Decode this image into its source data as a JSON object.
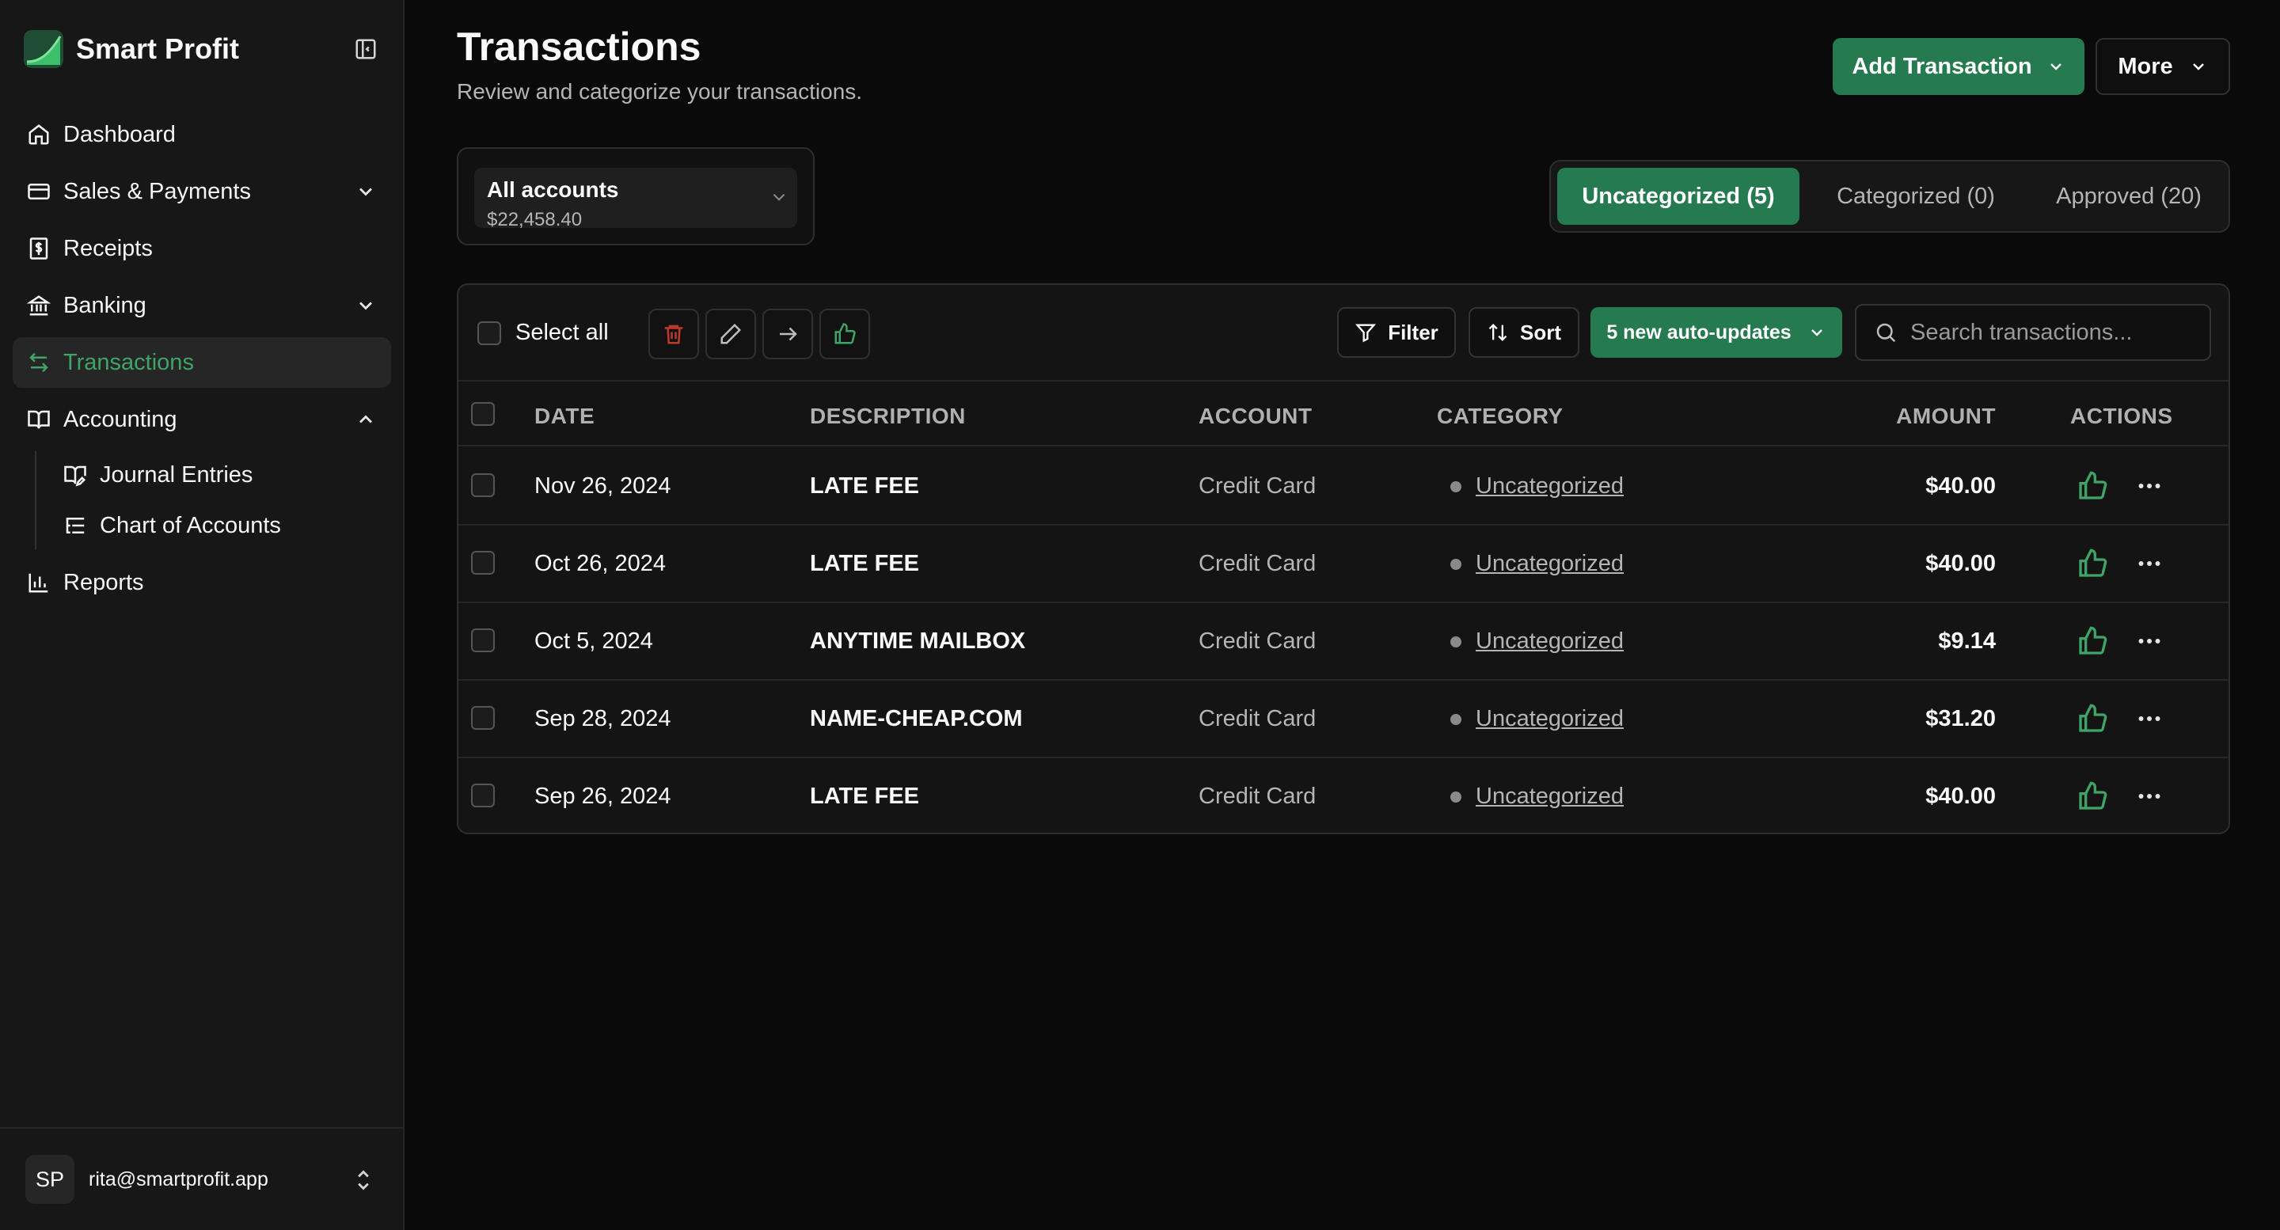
{
  "brand": {
    "name": "Smart Profit"
  },
  "sidebar": {
    "items": [
      {
        "label": "Dashboard",
        "icon": "home-icon"
      },
      {
        "label": "Sales & Payments",
        "icon": "card-icon"
      },
      {
        "label": "Receipts",
        "icon": "receipt-icon"
      },
      {
        "label": "Banking",
        "icon": "bank-icon"
      },
      {
        "label": "Transactions",
        "icon": "transfer-icon",
        "active": true
      },
      {
        "label": "Accounting",
        "icon": "book-icon"
      },
      {
        "label": "Reports",
        "icon": "bar-chart-icon"
      }
    ],
    "accounting_children": [
      {
        "label": "Journal Entries",
        "icon": "book-edit-icon"
      },
      {
        "label": "Chart of Accounts",
        "icon": "list-tree-icon"
      }
    ]
  },
  "user": {
    "initials": "SP",
    "email": "rita@smartprofit.app"
  },
  "header": {
    "title": "Transactions",
    "subtitle": "Review and categorize your transactions.",
    "add_label": "Add Transaction",
    "more_label": "More"
  },
  "account": {
    "name": "All accounts",
    "balance": "$22,458.40"
  },
  "tabs": {
    "uncategorized": "Uncategorized (5)",
    "categorized": "Categorized (0)",
    "approved": "Approved (20)"
  },
  "toolbar": {
    "select_all": "Select all",
    "filter": "Filter",
    "sort": "Sort",
    "auto_updates": "5 new auto-updates",
    "search_placeholder": "Search transactions..."
  },
  "table": {
    "columns": {
      "date": "DATE",
      "description": "DESCRIPTION",
      "account": "ACCOUNT",
      "category": "CATEGORY",
      "amount": "AMOUNT",
      "actions": "ACTIONS"
    },
    "rows": [
      {
        "date": "Nov 26, 2024",
        "description": "LATE FEE",
        "account": "Credit Card",
        "category": "Uncategorized",
        "amount": "$40.00"
      },
      {
        "date": "Oct 26, 2024",
        "description": "LATE FEE",
        "account": "Credit Card",
        "category": "Uncategorized",
        "amount": "$40.00"
      },
      {
        "date": "Oct 5, 2024",
        "description": "ANYTIME MAILBOX",
        "account": "Credit Card",
        "category": "Uncategorized",
        "amount": "$9.14"
      },
      {
        "date": "Sep 28, 2024",
        "description": "NAME-CHEAP.COM",
        "account": "Credit Card",
        "category": "Uncategorized",
        "amount": "$31.20"
      },
      {
        "date": "Sep 26, 2024",
        "description": "LATE FEE",
        "account": "Credit Card",
        "category": "Uncategorized",
        "amount": "$40.00"
      }
    ]
  },
  "colors": {
    "accent": "#257a4f",
    "active_text": "#3fa468",
    "background": "#0a0a0a",
    "sidebar": "#171717",
    "danger": "#c0392b"
  }
}
